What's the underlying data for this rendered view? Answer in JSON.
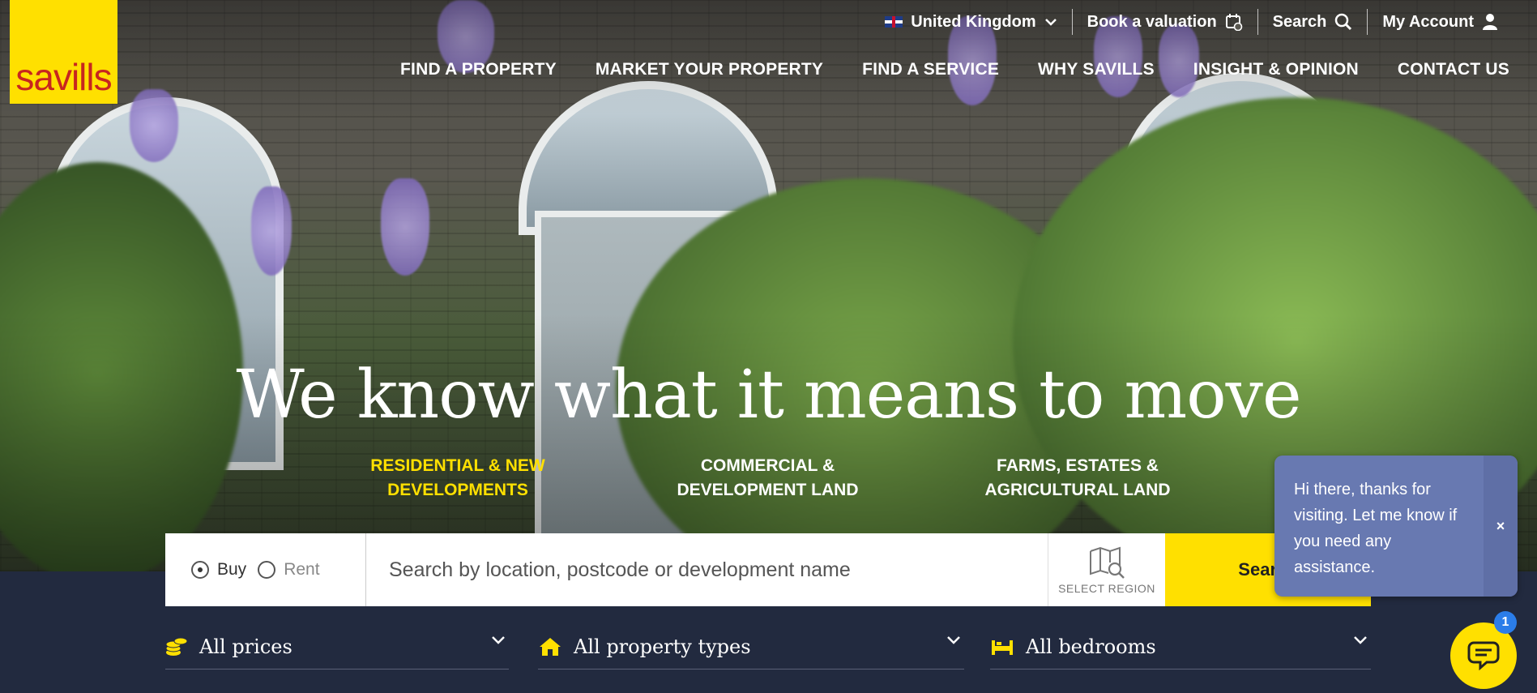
{
  "brand": {
    "logo_text": "savills",
    "logo_bg": "#ffe000",
    "logo_text_color": "#c7261f"
  },
  "utility_nav": {
    "country": "United Kingdom",
    "valuation": "Book a valuation",
    "search": "Search",
    "account": "My Account"
  },
  "main_nav": {
    "items": [
      "FIND A PROPERTY",
      "MARKET YOUR PROPERTY",
      "FIND A SERVICE",
      "WHY SAVILLS",
      "INSIGHT & OPINION",
      "CONTACT US"
    ]
  },
  "hero": {
    "headline": "We know what it means to move"
  },
  "tabs": {
    "items": [
      {
        "line1": "RESIDENTIAL & NEW",
        "line2": "DEVELOPMENTS",
        "active": true
      },
      {
        "line1": "COMMERCIAL &",
        "line2": "DEVELOPMENT LAND",
        "active": false
      },
      {
        "line1": "FARMS, ESTATES &",
        "line2": "AGRICULTURAL LAND",
        "active": false
      }
    ]
  },
  "search": {
    "buy_label": "Buy",
    "rent_label": "Rent",
    "selected": "Buy",
    "placeholder": "Search by location, postcode or development name",
    "region_label": "SELECT REGION",
    "button_label": "Search"
  },
  "filters": {
    "price": "All prices",
    "property_type": "All property types",
    "bedrooms": "All bedrooms"
  },
  "chat": {
    "message": "Hi there, thanks for visiting. Let me know if you need any assistance.",
    "close": "×",
    "badge_count": "1"
  },
  "colors": {
    "accent": "#ffe000",
    "band": "#222a3f",
    "chat_bg": "#6879b1"
  },
  "icons": [
    "chevron-down-icon",
    "calendar-icon",
    "search-icon",
    "user-icon",
    "map-search-icon",
    "coins-icon",
    "house-icon",
    "bed-icon",
    "chat-icon"
  ]
}
